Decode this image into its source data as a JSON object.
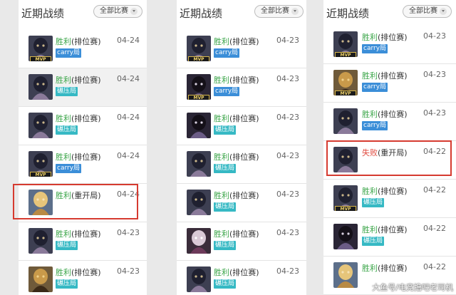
{
  "panels": [
    {
      "title": "近期战绩",
      "filter_label": "全部比赛",
      "rows": [
        {
          "outcome": "胜利",
          "mode": "(排位赛)",
          "date": "04-24",
          "badge": "carry局",
          "badge_type": "carry",
          "mvp": "MVP",
          "avatar": "dark-knight"
        },
        {
          "outcome": "胜利",
          "mode": "(排位赛)",
          "date": "04-24",
          "badge": "碾压局",
          "badge_type": "stomp",
          "mvp": "",
          "avatar": "dark-knight"
        },
        {
          "outcome": "胜利",
          "mode": "(排位赛)",
          "date": "04-24",
          "badge": "碾压局",
          "badge_type": "stomp",
          "mvp": "",
          "avatar": "dark-knight"
        },
        {
          "outcome": "胜利",
          "mode": "(排位赛)",
          "date": "04-24",
          "badge": "carry局",
          "badge_type": "carry",
          "mvp": "MVP",
          "avatar": "dark-knight"
        },
        {
          "outcome": "胜利",
          "mode": "(重开局)",
          "date": "04-24",
          "badge": "",
          "badge_type": "",
          "mvp": "",
          "avatar": "blonde"
        },
        {
          "outcome": "胜利",
          "mode": "(排位赛)",
          "date": "04-23",
          "badge": "碾压局",
          "badge_type": "stomp",
          "mvp": "",
          "avatar": "dark-knight"
        },
        {
          "outcome": "胜利",
          "mode": "(排位赛)",
          "date": "04-23",
          "badge": "碾压局",
          "badge_type": "stomp",
          "mvp": "",
          "avatar": "bronze-helmet"
        }
      ]
    },
    {
      "title": "近期战绩",
      "filter_label": "全部比赛",
      "rows": [
        {
          "outcome": "胜利",
          "mode": "(排位赛)",
          "date": "04-23",
          "badge": "carry局",
          "badge_type": "carry",
          "mvp": "MVP",
          "avatar": "dark-knight"
        },
        {
          "outcome": "胜利",
          "mode": "(排位赛)",
          "date": "04-23",
          "badge": "carry局",
          "badge_type": "carry",
          "mvp": "MVP",
          "avatar": "dark-mage"
        },
        {
          "outcome": "胜利",
          "mode": "(排位赛)",
          "date": "04-23",
          "badge": "碾压局",
          "badge_type": "stomp",
          "mvp": "",
          "avatar": "dark-mage"
        },
        {
          "outcome": "胜利",
          "mode": "(排位赛)",
          "date": "04-23",
          "badge": "碾压局",
          "badge_type": "stomp",
          "mvp": "",
          "avatar": "dark-knight"
        },
        {
          "outcome": "胜利",
          "mode": "(排位赛)",
          "date": "04-23",
          "badge": "碾压局",
          "badge_type": "stomp",
          "mvp": "",
          "avatar": "dark-knight"
        },
        {
          "outcome": "胜利",
          "mode": "(排位赛)",
          "date": "04-23",
          "badge": "碾压局",
          "badge_type": "stomp",
          "mvp": "",
          "avatar": "pale-face"
        },
        {
          "outcome": "胜利",
          "mode": "(排位赛)",
          "date": "04-23",
          "badge": "碾压局",
          "badge_type": "stomp",
          "mvp": "",
          "avatar": "dark-knight"
        }
      ]
    },
    {
      "title": "近期战绩",
      "filter_label": "全部比赛",
      "rows": [
        {
          "outcome": "胜利",
          "mode": "(排位赛)",
          "date": "04-23",
          "badge": "carry局",
          "badge_type": "carry",
          "mvp": "MVP",
          "avatar": "dark-knight"
        },
        {
          "outcome": "胜利",
          "mode": "(排位赛)",
          "date": "04-23",
          "badge": "carry局",
          "badge_type": "carry",
          "mvp": "MVP",
          "avatar": "bronze-helmet"
        },
        {
          "outcome": "胜利",
          "mode": "(排位赛)",
          "date": "04-23",
          "badge": "carry局",
          "badge_type": "carry",
          "mvp": "",
          "avatar": "dark-knight"
        },
        {
          "outcome": "失败",
          "mode": "(重开局)",
          "date": "04-22",
          "badge": "",
          "badge_type": "",
          "mvp": "",
          "avatar": "dark-knight",
          "lose": true
        },
        {
          "outcome": "胜利",
          "mode": "(排位赛)",
          "date": "04-22",
          "badge": "碾压局",
          "badge_type": "stomp",
          "mvp": "MVP",
          "avatar": "dark-knight"
        },
        {
          "outcome": "胜利",
          "mode": "(排位赛)",
          "date": "04-22",
          "badge": "碾压局",
          "badge_type": "stomp",
          "mvp": "",
          "avatar": "dark-mage"
        },
        {
          "outcome": "胜利",
          "mode": "(排位赛)",
          "date": "04-22",
          "badge": "",
          "badge_type": "",
          "mvp": "",
          "avatar": "blonde"
        }
      ]
    }
  ],
  "watermark": "大鱼号/电竞撸吧老司机",
  "colors": {
    "win": "#3aa548",
    "lose": "#e04a3e",
    "carry_badge": "#3b8ed8",
    "stomp_badge": "#36b9c4",
    "highlight": "#d63b30"
  }
}
